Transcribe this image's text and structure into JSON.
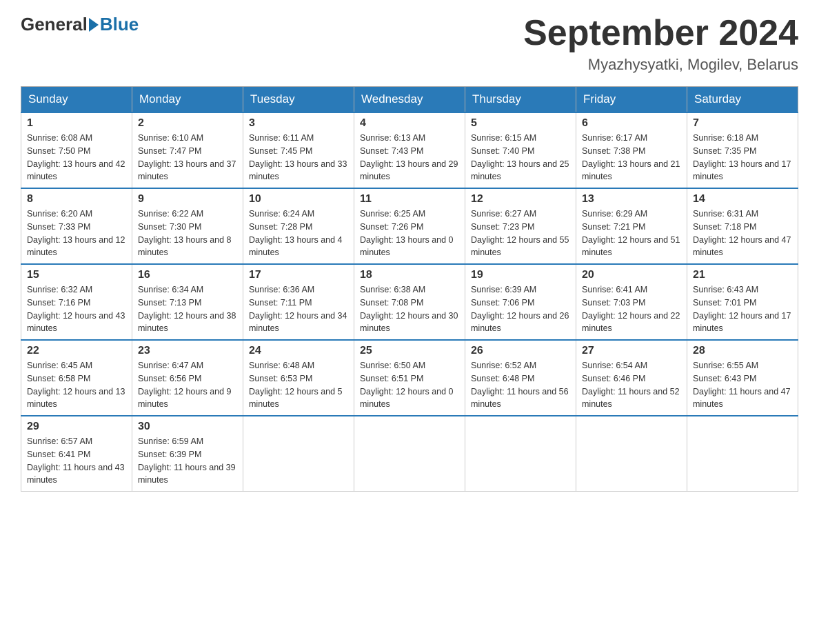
{
  "header": {
    "logo_general": "General",
    "logo_blue": "Blue",
    "title": "September 2024",
    "subtitle": "Myazhysyatki, Mogilev, Belarus"
  },
  "columns": [
    "Sunday",
    "Monday",
    "Tuesday",
    "Wednesday",
    "Thursday",
    "Friday",
    "Saturday"
  ],
  "weeks": [
    [
      {
        "day": "1",
        "sunrise": "6:08 AM",
        "sunset": "7:50 PM",
        "daylight": "13 hours and 42 minutes."
      },
      {
        "day": "2",
        "sunrise": "6:10 AM",
        "sunset": "7:47 PM",
        "daylight": "13 hours and 37 minutes."
      },
      {
        "day": "3",
        "sunrise": "6:11 AM",
        "sunset": "7:45 PM",
        "daylight": "13 hours and 33 minutes."
      },
      {
        "day": "4",
        "sunrise": "6:13 AM",
        "sunset": "7:43 PM",
        "daylight": "13 hours and 29 minutes."
      },
      {
        "day": "5",
        "sunrise": "6:15 AM",
        "sunset": "7:40 PM",
        "daylight": "13 hours and 25 minutes."
      },
      {
        "day": "6",
        "sunrise": "6:17 AM",
        "sunset": "7:38 PM",
        "daylight": "13 hours and 21 minutes."
      },
      {
        "day": "7",
        "sunrise": "6:18 AM",
        "sunset": "7:35 PM",
        "daylight": "13 hours and 17 minutes."
      }
    ],
    [
      {
        "day": "8",
        "sunrise": "6:20 AM",
        "sunset": "7:33 PM",
        "daylight": "13 hours and 12 minutes."
      },
      {
        "day": "9",
        "sunrise": "6:22 AM",
        "sunset": "7:30 PM",
        "daylight": "13 hours and 8 minutes."
      },
      {
        "day": "10",
        "sunrise": "6:24 AM",
        "sunset": "7:28 PM",
        "daylight": "13 hours and 4 minutes."
      },
      {
        "day": "11",
        "sunrise": "6:25 AM",
        "sunset": "7:26 PM",
        "daylight": "13 hours and 0 minutes."
      },
      {
        "day": "12",
        "sunrise": "6:27 AM",
        "sunset": "7:23 PM",
        "daylight": "12 hours and 55 minutes."
      },
      {
        "day": "13",
        "sunrise": "6:29 AM",
        "sunset": "7:21 PM",
        "daylight": "12 hours and 51 minutes."
      },
      {
        "day": "14",
        "sunrise": "6:31 AM",
        "sunset": "7:18 PM",
        "daylight": "12 hours and 47 minutes."
      }
    ],
    [
      {
        "day": "15",
        "sunrise": "6:32 AM",
        "sunset": "7:16 PM",
        "daylight": "12 hours and 43 minutes."
      },
      {
        "day": "16",
        "sunrise": "6:34 AM",
        "sunset": "7:13 PM",
        "daylight": "12 hours and 38 minutes."
      },
      {
        "day": "17",
        "sunrise": "6:36 AM",
        "sunset": "7:11 PM",
        "daylight": "12 hours and 34 minutes."
      },
      {
        "day": "18",
        "sunrise": "6:38 AM",
        "sunset": "7:08 PM",
        "daylight": "12 hours and 30 minutes."
      },
      {
        "day": "19",
        "sunrise": "6:39 AM",
        "sunset": "7:06 PM",
        "daylight": "12 hours and 26 minutes."
      },
      {
        "day": "20",
        "sunrise": "6:41 AM",
        "sunset": "7:03 PM",
        "daylight": "12 hours and 22 minutes."
      },
      {
        "day": "21",
        "sunrise": "6:43 AM",
        "sunset": "7:01 PM",
        "daylight": "12 hours and 17 minutes."
      }
    ],
    [
      {
        "day": "22",
        "sunrise": "6:45 AM",
        "sunset": "6:58 PM",
        "daylight": "12 hours and 13 minutes."
      },
      {
        "day": "23",
        "sunrise": "6:47 AM",
        "sunset": "6:56 PM",
        "daylight": "12 hours and 9 minutes."
      },
      {
        "day": "24",
        "sunrise": "6:48 AM",
        "sunset": "6:53 PM",
        "daylight": "12 hours and 5 minutes."
      },
      {
        "day": "25",
        "sunrise": "6:50 AM",
        "sunset": "6:51 PM",
        "daylight": "12 hours and 0 minutes."
      },
      {
        "day": "26",
        "sunrise": "6:52 AM",
        "sunset": "6:48 PM",
        "daylight": "11 hours and 56 minutes."
      },
      {
        "day": "27",
        "sunrise": "6:54 AM",
        "sunset": "6:46 PM",
        "daylight": "11 hours and 52 minutes."
      },
      {
        "day": "28",
        "sunrise": "6:55 AM",
        "sunset": "6:43 PM",
        "daylight": "11 hours and 47 minutes."
      }
    ],
    [
      {
        "day": "29",
        "sunrise": "6:57 AM",
        "sunset": "6:41 PM",
        "daylight": "11 hours and 43 minutes."
      },
      {
        "day": "30",
        "sunrise": "6:59 AM",
        "sunset": "6:39 PM",
        "daylight": "11 hours and 39 minutes."
      },
      null,
      null,
      null,
      null,
      null
    ]
  ],
  "labels": {
    "sunrise": "Sunrise:",
    "sunset": "Sunset:",
    "daylight": "Daylight:"
  }
}
